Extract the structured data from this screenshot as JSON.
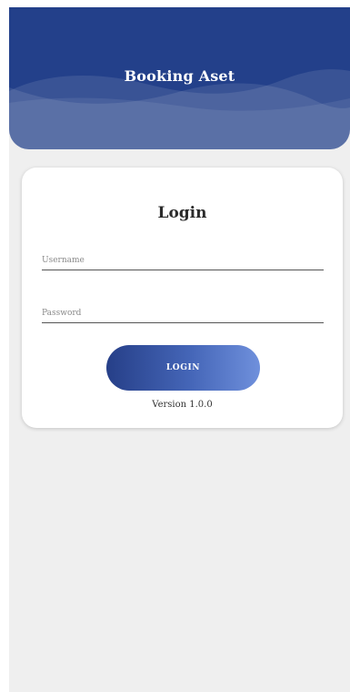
{
  "header": {
    "title": "Booking Aset"
  },
  "login_card": {
    "title": "Login",
    "username": {
      "placeholder": "Username",
      "value": ""
    },
    "password": {
      "placeholder": "Password",
      "value": ""
    },
    "login_button_label": "LOGIN",
    "version_text": "Version 1.0.0"
  },
  "colors": {
    "header_bg": "#23408a",
    "button_gradient_start": "#263f88",
    "button_gradient_end": "#6f90dc",
    "page_bg": "#efefef",
    "card_bg": "#ffffff"
  }
}
